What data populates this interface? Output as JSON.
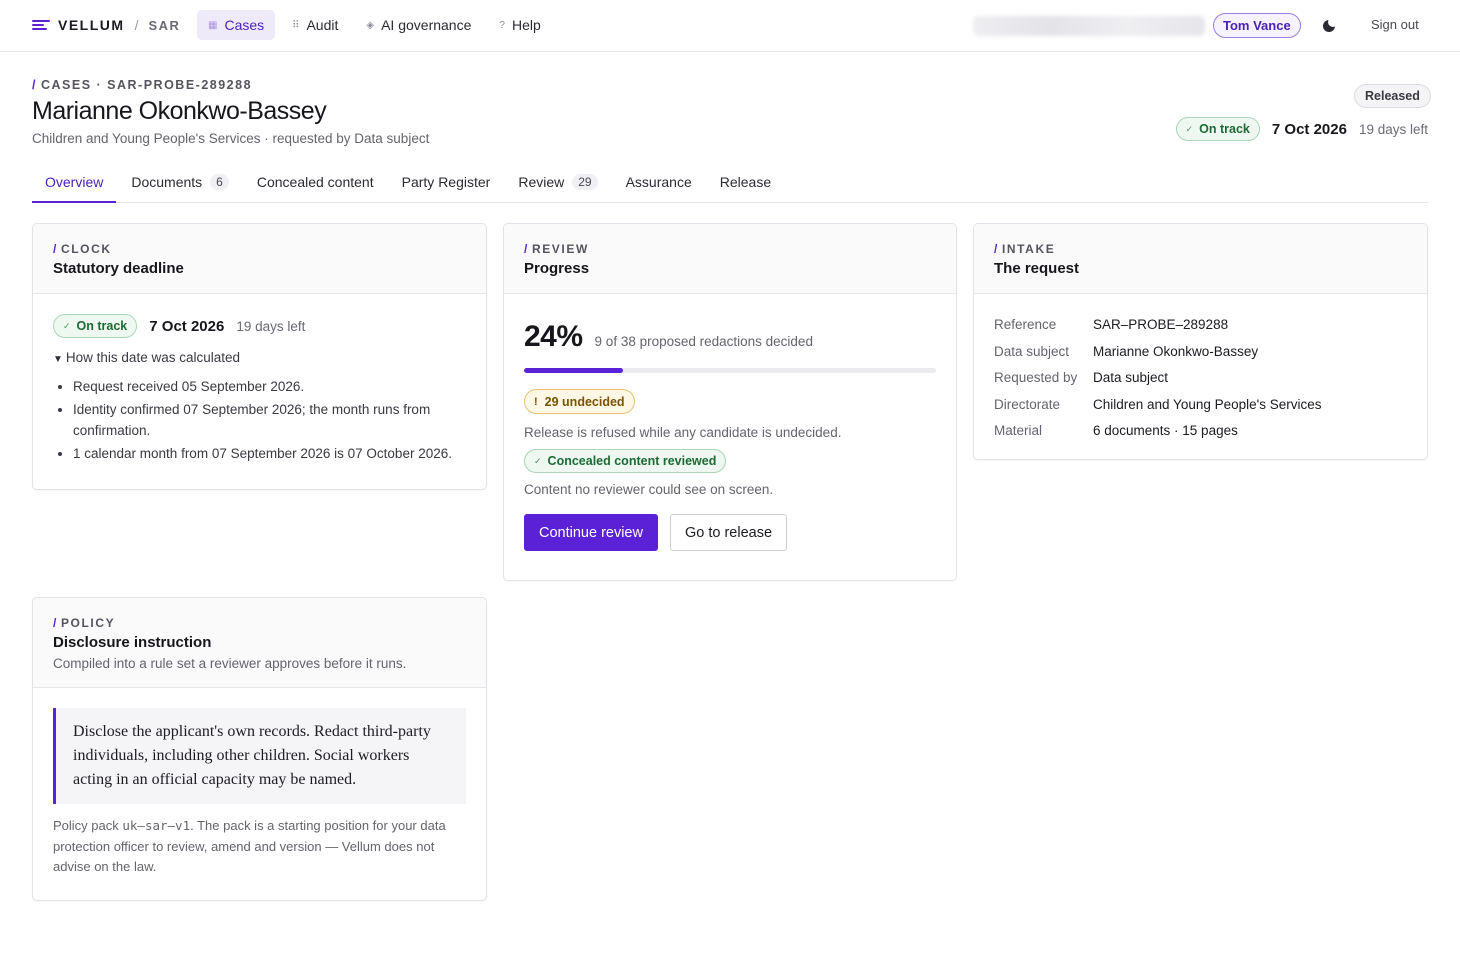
{
  "topbar": {
    "brand": "VELLUM",
    "separator": "/",
    "product": "SAR",
    "nav": [
      {
        "label": "Cases",
        "icon": "cases-icon",
        "glyph": "▦",
        "active": true
      },
      {
        "label": "Audit",
        "icon": "audit-icon",
        "glyph": "⠿",
        "active": false
      },
      {
        "label": "AI governance",
        "icon": "ai-governance-icon",
        "glyph": "◈",
        "active": false
      },
      {
        "label": "Help",
        "icon": "help-icon",
        "glyph": "?",
        "active": false
      }
    ],
    "user": "Tom Vance",
    "theme_icon": "moon-icon",
    "signout": "Sign out"
  },
  "header": {
    "crumb_slash": "/",
    "crumb": "CASES · SAR-PROBE-289288",
    "title": "Marianne Okonkwo-Bassey",
    "subtitle": "Children and Young People's Services · requested by Data subject",
    "status": "Released",
    "deadline_status": "On track",
    "deadline_date": "7 Oct 2026",
    "days_left": "19 days left"
  },
  "tabs": [
    {
      "label": "Overview",
      "count": "",
      "active": true
    },
    {
      "label": "Documents",
      "count": "6",
      "active": false
    },
    {
      "label": "Concealed content",
      "count": "",
      "active": false
    },
    {
      "label": "Party Register",
      "count": "",
      "active": false
    },
    {
      "label": "Review",
      "count": "29",
      "active": false
    },
    {
      "label": "Assurance",
      "count": "",
      "active": false
    },
    {
      "label": "Release",
      "count": "",
      "active": false
    }
  ],
  "clock": {
    "eyebrow": "CLOCK",
    "title": "Statutory deadline",
    "status": "On track",
    "date": "7 Oct 2026",
    "days_left": "19 days left",
    "disclosure": "How this date was calculated",
    "bullets": [
      "Request received 05 September 2026.",
      "Identity confirmed 07 September 2026; the month runs from confirmation.",
      "1 calendar month from 07 September 2026 is 07 October 2026."
    ]
  },
  "review": {
    "eyebrow": "REVIEW",
    "title": "Progress",
    "percent": "24%",
    "progress_fraction": 0.24,
    "note": "9 of 38 proposed redactions decided",
    "undecided": "29 undecided",
    "undecided_glyph": "!",
    "refusal": "Release is refused while any candidate is undecided.",
    "concealed": "Concealed content reviewed",
    "concealed_note": "Content no reviewer could see on screen.",
    "primary_action": "Continue review",
    "secondary_action": "Go to release"
  },
  "intake": {
    "eyebrow": "INTAKE",
    "title": "The request",
    "rows": [
      {
        "key": "Reference",
        "value": "SAR–PROBE–289288"
      },
      {
        "key": "Data subject",
        "value": "Marianne Okonkwo-Bassey"
      },
      {
        "key": "Requested by",
        "value": "Data subject"
      },
      {
        "key": "Directorate",
        "value": "Children and Young People's Services"
      },
      {
        "key": "Material",
        "value": "6 documents · 15 pages"
      }
    ]
  },
  "policy": {
    "eyebrow": "POLICY",
    "title": "Disclosure instruction",
    "desc": "Compiled into a rule set a reviewer approves before it runs.",
    "instruction": "Disclose the applicant's own records. Redact third-party individuals, including other children. Social workers acting in an official capacity may be named.",
    "note_prefix": "Policy pack ",
    "pack_id": "uk–sar–v1",
    "note_suffix": ". The pack is a starting position for your data protection officer to review, amend and version — Vellum does not advise on the law."
  },
  "colors": {
    "accent": "#5b21d6",
    "success": "#1d6a35",
    "warning": "#7a5300"
  }
}
